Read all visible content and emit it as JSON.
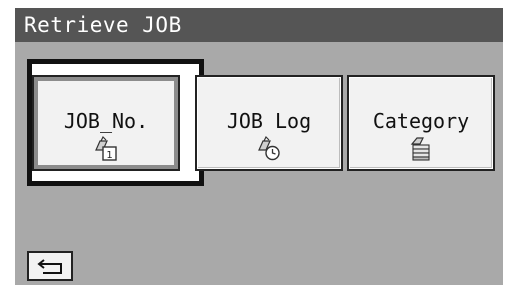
{
  "header": {
    "title": "Retrieve JOB"
  },
  "buttons": [
    {
      "label": "JOB_No.",
      "icon": "job-number-icon",
      "selected": true
    },
    {
      "label": "JOB Log",
      "icon": "job-log-icon",
      "selected": false
    },
    {
      "label": "Category",
      "icon": "category-icon",
      "selected": false
    }
  ],
  "footer": {
    "back_icon": "return-arrow-icon"
  },
  "colors": {
    "titlebar": "#555555",
    "background": "#a9a9a9",
    "button": "#f2f2f2",
    "selection_frame": "#111111"
  }
}
